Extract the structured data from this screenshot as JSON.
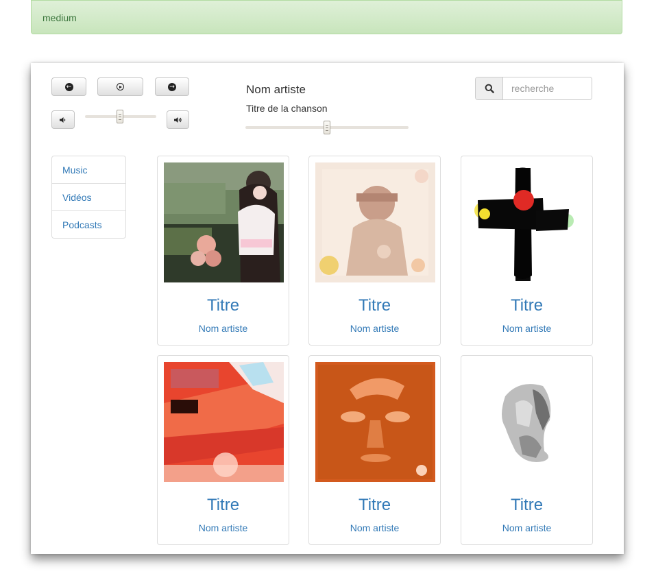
{
  "alert": {
    "text": "medium"
  },
  "player": {
    "prev_icon": "arrow-left-icon",
    "play_icon": "play-circle-icon",
    "next_icon": "arrow-right-icon",
    "volume_down_icon": "volume-down-icon",
    "volume_up_icon": "volume-up-icon",
    "volume_level": 0.49,
    "now_playing": {
      "artist": "Nom artiste",
      "song": "Titre de la chanson"
    },
    "progress": 0.5
  },
  "search": {
    "icon": "search-icon",
    "placeholder": "recherche",
    "value": ""
  },
  "nav": {
    "items": [
      {
        "label": "Music"
      },
      {
        "label": "Vidéos"
      },
      {
        "label": "Podcasts"
      }
    ]
  },
  "cards": [
    {
      "title": "Titre",
      "artist": "Nom artiste",
      "cover": "album-cover-1"
    },
    {
      "title": "Titre",
      "artist": "Nom artiste",
      "cover": "album-cover-2"
    },
    {
      "title": "Titre",
      "artist": "Nom artiste",
      "cover": "album-cover-3"
    },
    {
      "title": "Titre",
      "artist": "Nom artiste",
      "cover": "album-cover-4"
    },
    {
      "title": "Titre",
      "artist": "Nom artiste",
      "cover": "album-cover-5"
    },
    {
      "title": "Titre",
      "artist": "Nom artiste",
      "cover": "album-cover-6"
    }
  ],
  "colors": {
    "link": "#337ab7",
    "alert_bg": "#dff0d8",
    "alert_text": "#3c763d"
  }
}
